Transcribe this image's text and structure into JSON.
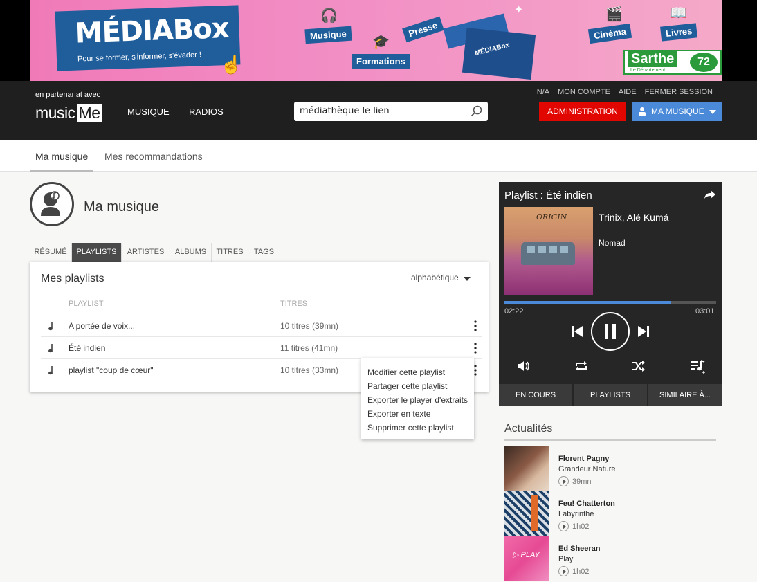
{
  "banner": {
    "logo_text_a": "MÉDIA",
    "logo_text_b": "Box",
    "tagline": "Pour se former, s'informer, s'évader !",
    "tags": [
      "Musique",
      "Formations",
      "Presse",
      "Cinéma",
      "Livres"
    ],
    "box_label": "MÉDIABox",
    "sponsor": "Sarthe",
    "sponsor_sub": "Le Département",
    "sponsor_mark": "72"
  },
  "header": {
    "partner": "en partenariat avec",
    "logo_a": "music",
    "logo_b": "Me",
    "nav": [
      "MUSIQUE",
      "RADIOS"
    ],
    "search_value": "médiathèque le lien",
    "toplinks": [
      "N/A",
      "MON COMPTE",
      "AIDE",
      "FERMER SESSION"
    ],
    "admin_label": "ADMINISTRATION",
    "mymusic_label": "MA MUSIQUE",
    "accent_red": "#e10600",
    "accent_blue": "#4b8ad8"
  },
  "subnav": {
    "tabs": [
      "Ma musique",
      "Mes recommandations"
    ]
  },
  "page": {
    "title": "Ma musique",
    "tabs": [
      "RÉSUMÉ",
      "PLAYLISTS",
      "ARTISTES",
      "ALBUMS",
      "TITRES",
      "TAGS"
    ],
    "active_tab": "PLAYLISTS"
  },
  "playlists": {
    "title": "Mes playlists",
    "sort": "alphabétique",
    "col_playlist": "PLAYLIST",
    "col_titres": "TITRES",
    "rows": [
      {
        "name": "A portée de voix...",
        "count": "10 titres (39mn)"
      },
      {
        "name": "Été indien",
        "count": "11 titres (41mn)"
      },
      {
        "name": "playlist \"coup de cœur\"",
        "count": "10 titres (33mn)"
      }
    ]
  },
  "context_menu": {
    "items": [
      "Modifier cette playlist",
      "Partager cette playlist",
      "Exporter le player d'extraits",
      "Exporter en texte",
      "Supprimer cette playlist"
    ]
  },
  "player": {
    "title": "Playlist :  Été indien",
    "cover_text": "ORIGIN",
    "artist": "Trinix, Alé Kumá",
    "album": "Nomad",
    "time_current": "02:22",
    "time_total": "03:01",
    "progress": 0.787,
    "tabs": [
      "EN COURS",
      "PLAYLISTS",
      "SIMILAIRE À..."
    ]
  },
  "news": {
    "title": "Actualités",
    "items": [
      {
        "artist": "Florent Pagny",
        "album": "Grandeur Nature",
        "duration": "39mn"
      },
      {
        "artist": "Feu! Chatterton",
        "album": "Labyrinthe",
        "duration": "1h02"
      },
      {
        "artist": "Ed Sheeran",
        "album": "Play",
        "duration": "1h02"
      }
    ]
  }
}
